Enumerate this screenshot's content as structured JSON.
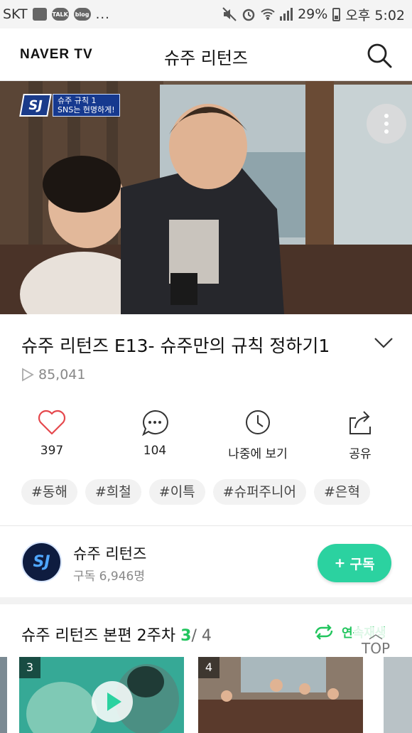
{
  "status_bar": {
    "carrier": "SKT",
    "app_icons": [
      "image-icon",
      "kakaotalk-icon",
      "blog-icon"
    ],
    "talk_label": "TALK",
    "blog_label": "blog",
    "more": "...",
    "battery": "29%",
    "time": "오후 5:02"
  },
  "header": {
    "logo": "NAVER TV",
    "title": "슈주 리턴즈"
  },
  "video": {
    "badge_logo": "SJ",
    "badge_line1": "슈주 규칙 1",
    "badge_line2": "SNS는 현명하게!"
  },
  "episode": {
    "title": "슈주 리턴즈 E13- 슈주만의 규칙 정하기1",
    "views": "85,041"
  },
  "actions": {
    "like": "397",
    "comment": "104",
    "later": "나중에 보기",
    "share": "공유"
  },
  "tags": [
    "#동해",
    "#희철",
    "#이특",
    "#슈퍼주니어",
    "#은혁"
  ],
  "channel": {
    "avatar": "SJ",
    "name": "슈주 리턴즈",
    "subscribers": "구독 6,946명",
    "subscribe_label": "구독"
  },
  "playlist": {
    "title": "슈주 리턴즈 본편 2주차",
    "current": "3",
    "total": "/ 4",
    "autoplay": "연속재생",
    "top": "TOP",
    "items": [
      {
        "num": "3"
      },
      {
        "num": "4"
      }
    ]
  },
  "colors": {
    "accent_green": "#22c55e",
    "subscribe_button": "#2bd2a0"
  }
}
